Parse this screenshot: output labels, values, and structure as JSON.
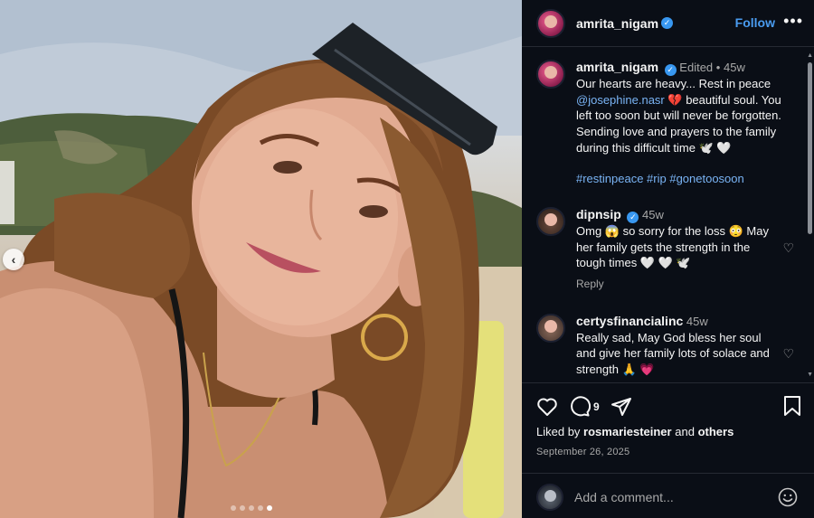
{
  "post": {
    "username": "amrita_nigam",
    "follow_label": "Follow",
    "more_label": "•••"
  },
  "caption": {
    "username": "amrita_nigam",
    "edited_label": "Edited",
    "separator": "•",
    "age": "45w",
    "text_1": "Our hearts are heavy... Rest in peace",
    "mention": "@josephine.nasr",
    "emoji_1": "💔",
    "text_2": "beautiful soul. You left too soon but will never be forgotten. Sending love and prayers to the family during this difficult time",
    "emoji_2": "🕊️ 🤍",
    "hashtags": "#restinpeace #rip #gonetoosoon"
  },
  "comments": [
    {
      "username": "dipnsip",
      "age": "45w",
      "text": "Omg 😱 so sorry for the loss 😳 May her family gets the strength in the tough times 🤍 🤍 🕊️",
      "reply_label": "Reply"
    },
    {
      "username": "certysfinancialinc",
      "age": "45w",
      "text": "Really sad, May God bless her soul and give her family lots of solace and strength 🙏 💗"
    }
  ],
  "actions": {
    "comment_count": "9",
    "liked_by_prefix": "Liked by",
    "liked_by_user": "rosmariesteiner",
    "liked_by_and": "and",
    "liked_by_others": "others",
    "date": "September 26, 2025"
  },
  "composer": {
    "placeholder": "Add a comment..."
  },
  "carousel": {
    "total_slides": 5,
    "active_index": 4
  },
  "colors": {
    "panel_bg": "#0a0e16",
    "link_blue": "#4a9cf0",
    "verified": "#3897f0",
    "muted": "#a8a8a8"
  }
}
